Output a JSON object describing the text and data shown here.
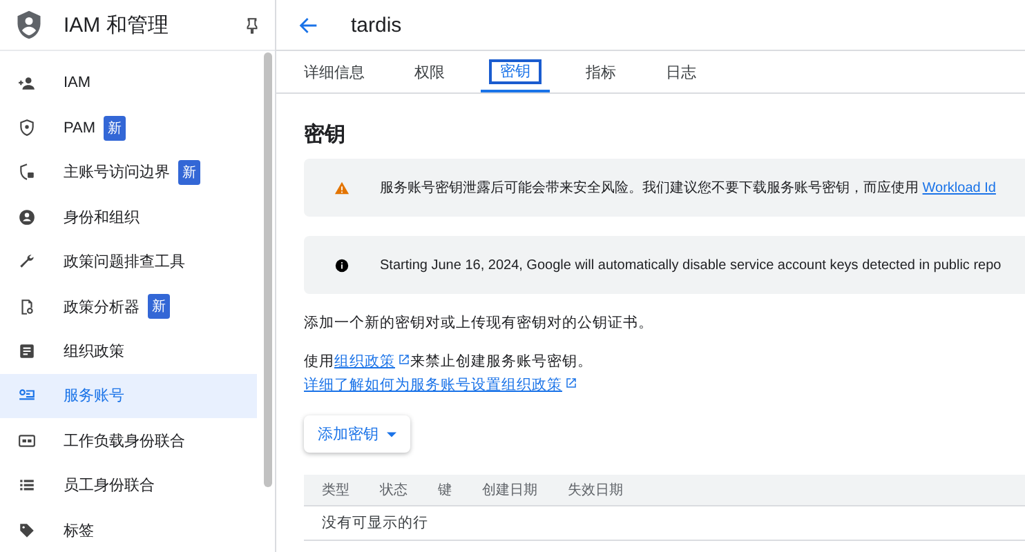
{
  "product": {
    "title": "IAM 和管理"
  },
  "sidebar": {
    "items": [
      {
        "label": "IAM",
        "selected": false
      },
      {
        "label": "PAM",
        "badge": "新",
        "selected": false
      },
      {
        "label": "主账号访问边界",
        "badge": "新",
        "selected": false
      },
      {
        "label": "身份和组织",
        "selected": false
      },
      {
        "label": "政策问题排查工具",
        "selected": false
      },
      {
        "label": "政策分析器",
        "badge": "新",
        "selected": false
      },
      {
        "label": "组织政策",
        "selected": false
      },
      {
        "label": "服务账号",
        "selected": true
      },
      {
        "label": "工作负载身份联合",
        "selected": false
      },
      {
        "label": "员工身份联合",
        "selected": false
      },
      {
        "label": "标签",
        "selected": false
      }
    ]
  },
  "page": {
    "title": "tardis"
  },
  "tabs": [
    {
      "label": "详细信息",
      "selected": false
    },
    {
      "label": "权限",
      "selected": false
    },
    {
      "label": "密钥",
      "selected": true
    },
    {
      "label": "指标",
      "selected": false
    },
    {
      "label": "日志",
      "selected": false
    }
  ],
  "section_title": "密钥",
  "banners": [
    {
      "kind": "warning",
      "text": "服务账号密钥泄露后可能会带来安全风险。我们建议您不要下载服务账号密钥，而应使用 ",
      "link": "Workload Id"
    },
    {
      "kind": "info",
      "text": "Starting June 16, 2024, Google will automatically disable service account keys detected in public repo"
    }
  ],
  "intro": "添加一个新的密钥对或上传现有密钥对的公钥证书。",
  "policy_sentence": {
    "before": "使用",
    "link": "组织政策",
    "after": "来禁止创建服务账号密钥。"
  },
  "learn_more_link": "详细了解如何为服务账号设置组织政策",
  "add_key_button": "添加密钥",
  "table": {
    "columns": [
      "类型",
      "状态",
      "键",
      "创建日期",
      "失效日期"
    ],
    "empty_text": "没有可显示的行"
  }
}
